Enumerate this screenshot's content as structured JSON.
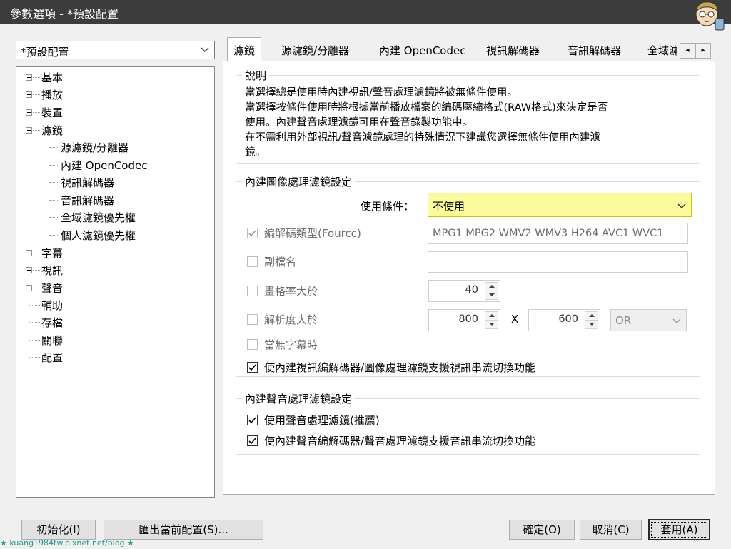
{
  "window": {
    "title": "參數選項 - *預設配置"
  },
  "profile_select": {
    "value": "*預設配置"
  },
  "tree": {
    "items": [
      {
        "label": "基本",
        "expander": "plus"
      },
      {
        "label": "播放",
        "expander": "plus"
      },
      {
        "label": "裝置",
        "expander": "plus"
      },
      {
        "label": "濾鏡",
        "expander": "minus"
      },
      {
        "label": "源濾鏡/分離器",
        "child": true
      },
      {
        "label": "內建 OpenCodec",
        "child": true
      },
      {
        "label": "視訊解碼器",
        "child": true
      },
      {
        "label": "音訊解碼器",
        "child": true
      },
      {
        "label": "全域濾鏡優先權",
        "child": true
      },
      {
        "label": "個人濾鏡優先權",
        "child": true
      },
      {
        "label": "字幕",
        "expander": "plus"
      },
      {
        "label": "視訊",
        "expander": "plus"
      },
      {
        "label": "聲音",
        "expander": "plus"
      },
      {
        "label": "輔助"
      },
      {
        "label": "存檔"
      },
      {
        "label": "關聯"
      },
      {
        "label": "配置"
      }
    ]
  },
  "tabs": [
    "濾鏡",
    "源濾鏡/分離器",
    "內建 OpenCodec",
    "視訊解碼器",
    "音訊解碼器",
    "全域濾"
  ],
  "tab_scroll": {
    "left": "◂",
    "right": "▸"
  },
  "description": {
    "title": "說明",
    "lines": [
      "當選擇總是使用時內建視訊/聲音處理濾鏡將被無條件使用。",
      "當選擇按條件使用時將根據當前播放檔案的編碼壓縮格式(RAW格式)來決定是否",
      "使用。內建聲音處理濾鏡可用在聲音錄製功能中。",
      "在不需利用外部視訊/聲音濾鏡處理的特殊情況下建議您選擇無條件使用內建濾",
      "鏡。"
    ]
  },
  "video_group": {
    "title": "內建圖像處理濾鏡設定",
    "use_condition_label": "使用條件：",
    "use_condition_value": "不使用",
    "fourcc_label": "編解碼類型(Fourcc)",
    "fourcc_value": "MPG1 MPG2 WMV2 WMV3 H264 AVC1 WVC1",
    "ext_label": "副檔名",
    "ext_value": "",
    "fps_label": "畫格率大於",
    "fps_value": "40",
    "res_label": "解析度大於",
    "res_w": "800",
    "res_x": "X",
    "res_h": "600",
    "res_op": "OR",
    "nosub_label": "當無字幕時",
    "switch_label": "使內建視訊編解碼器/圖像處理濾鏡支援視訊串流切換功能"
  },
  "audio_group": {
    "title": "內建聲音處理濾鏡設定",
    "use_audio_label": "使用聲音處理濾鏡(推薦)",
    "audio_switch_label": "使內建聲音編解碼器/聲音處理濾鏡支援音訊串流切換功能"
  },
  "buttons": {
    "init": "初始化(I)",
    "export": "匯出當前配置(S)...",
    "ok": "確定(O)",
    "cancel": "取消(C)",
    "apply": "套用(A)"
  },
  "watermark": "★ kuang1984tw.pixnet.net/blog ★",
  "colors": {
    "highlight": "#fbfb9c",
    "highlight_border": "#c9c900",
    "titlebar": "#3c3c3c"
  }
}
